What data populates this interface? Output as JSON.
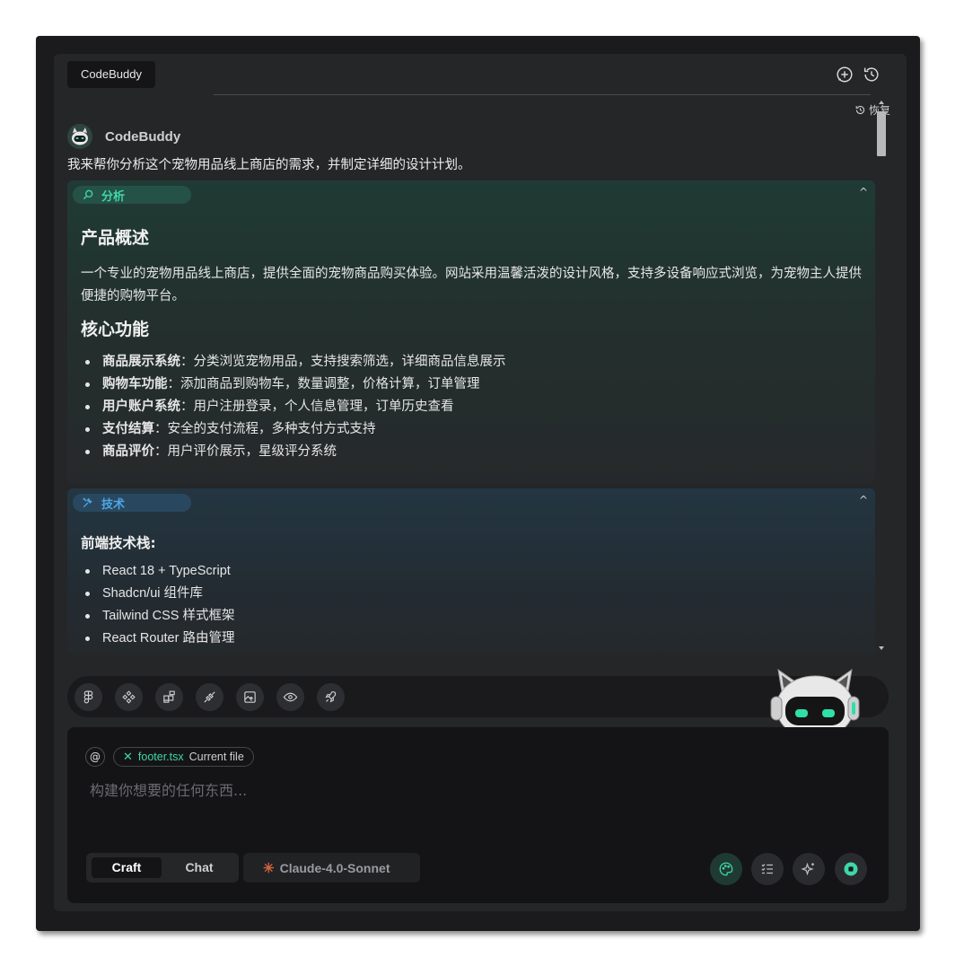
{
  "header": {
    "tab_label": "CodeBuddy",
    "icons": [
      "add-chat-icon",
      "history-icon"
    ]
  },
  "restore_label": "恢复",
  "message": {
    "author": "CodeBuddy",
    "intro": "我来帮你分析这个宠物用品线上商店的需求，并制定详细的设计计划。"
  },
  "analysis": {
    "badge": "分析",
    "overview_title": "产品概述",
    "overview_text": "一个专业的宠物用品线上商店，提供全面的宠物商品购买体验。网站采用温馨活泼的设计风格，支持多设备响应式浏览，为宠物主人提供便捷的购物平台。",
    "features_title": "核心功能",
    "features": [
      {
        "name": "商品展示系统",
        "desc": "：分类浏览宠物用品，支持搜索筛选，详细商品信息展示"
      },
      {
        "name": "购物车功能",
        "desc": "：添加商品到购物车，数量调整，价格计算，订单管理"
      },
      {
        "name": "用户账户系统",
        "desc": "：用户注册登录，个人信息管理，订单历史查看"
      },
      {
        "name": "支付结算",
        "desc": "：安全的支付流程，多种支付方式支持"
      },
      {
        "name": "商品评价",
        "desc": "：用户评价展示，星级评分系统"
      }
    ]
  },
  "tech": {
    "badge": "技术",
    "stack_title": "前端技术栈:",
    "stack": [
      "React 18 + TypeScript",
      "Shadcn/ui 组件库",
      "Tailwind CSS 样式框架",
      "React Router 路由管理"
    ]
  },
  "toolbar": {
    "tools": [
      "figma-icon",
      "component-icon",
      "widgets-icon",
      "plugin-icon",
      "image-upload-icon",
      "preview-eye-icon",
      "deploy-rocket-icon"
    ]
  },
  "composer": {
    "at_symbol": "@",
    "file_remove": "✕",
    "file_name": "footer.tsx",
    "file_tag": "Current file",
    "placeholder": "构建你想要的任何东西...",
    "mode_craft": "Craft",
    "mode_chat": "Chat",
    "model_name": "Claude-4.0-Sonnet",
    "actions": [
      "palette-icon",
      "checklist-icon",
      "sparkle-icon",
      "stop-icon"
    ]
  },
  "colors": {
    "accent": "#3fd7a6",
    "tech_accent": "#4ea6e6",
    "model_star": "#d0643f"
  }
}
